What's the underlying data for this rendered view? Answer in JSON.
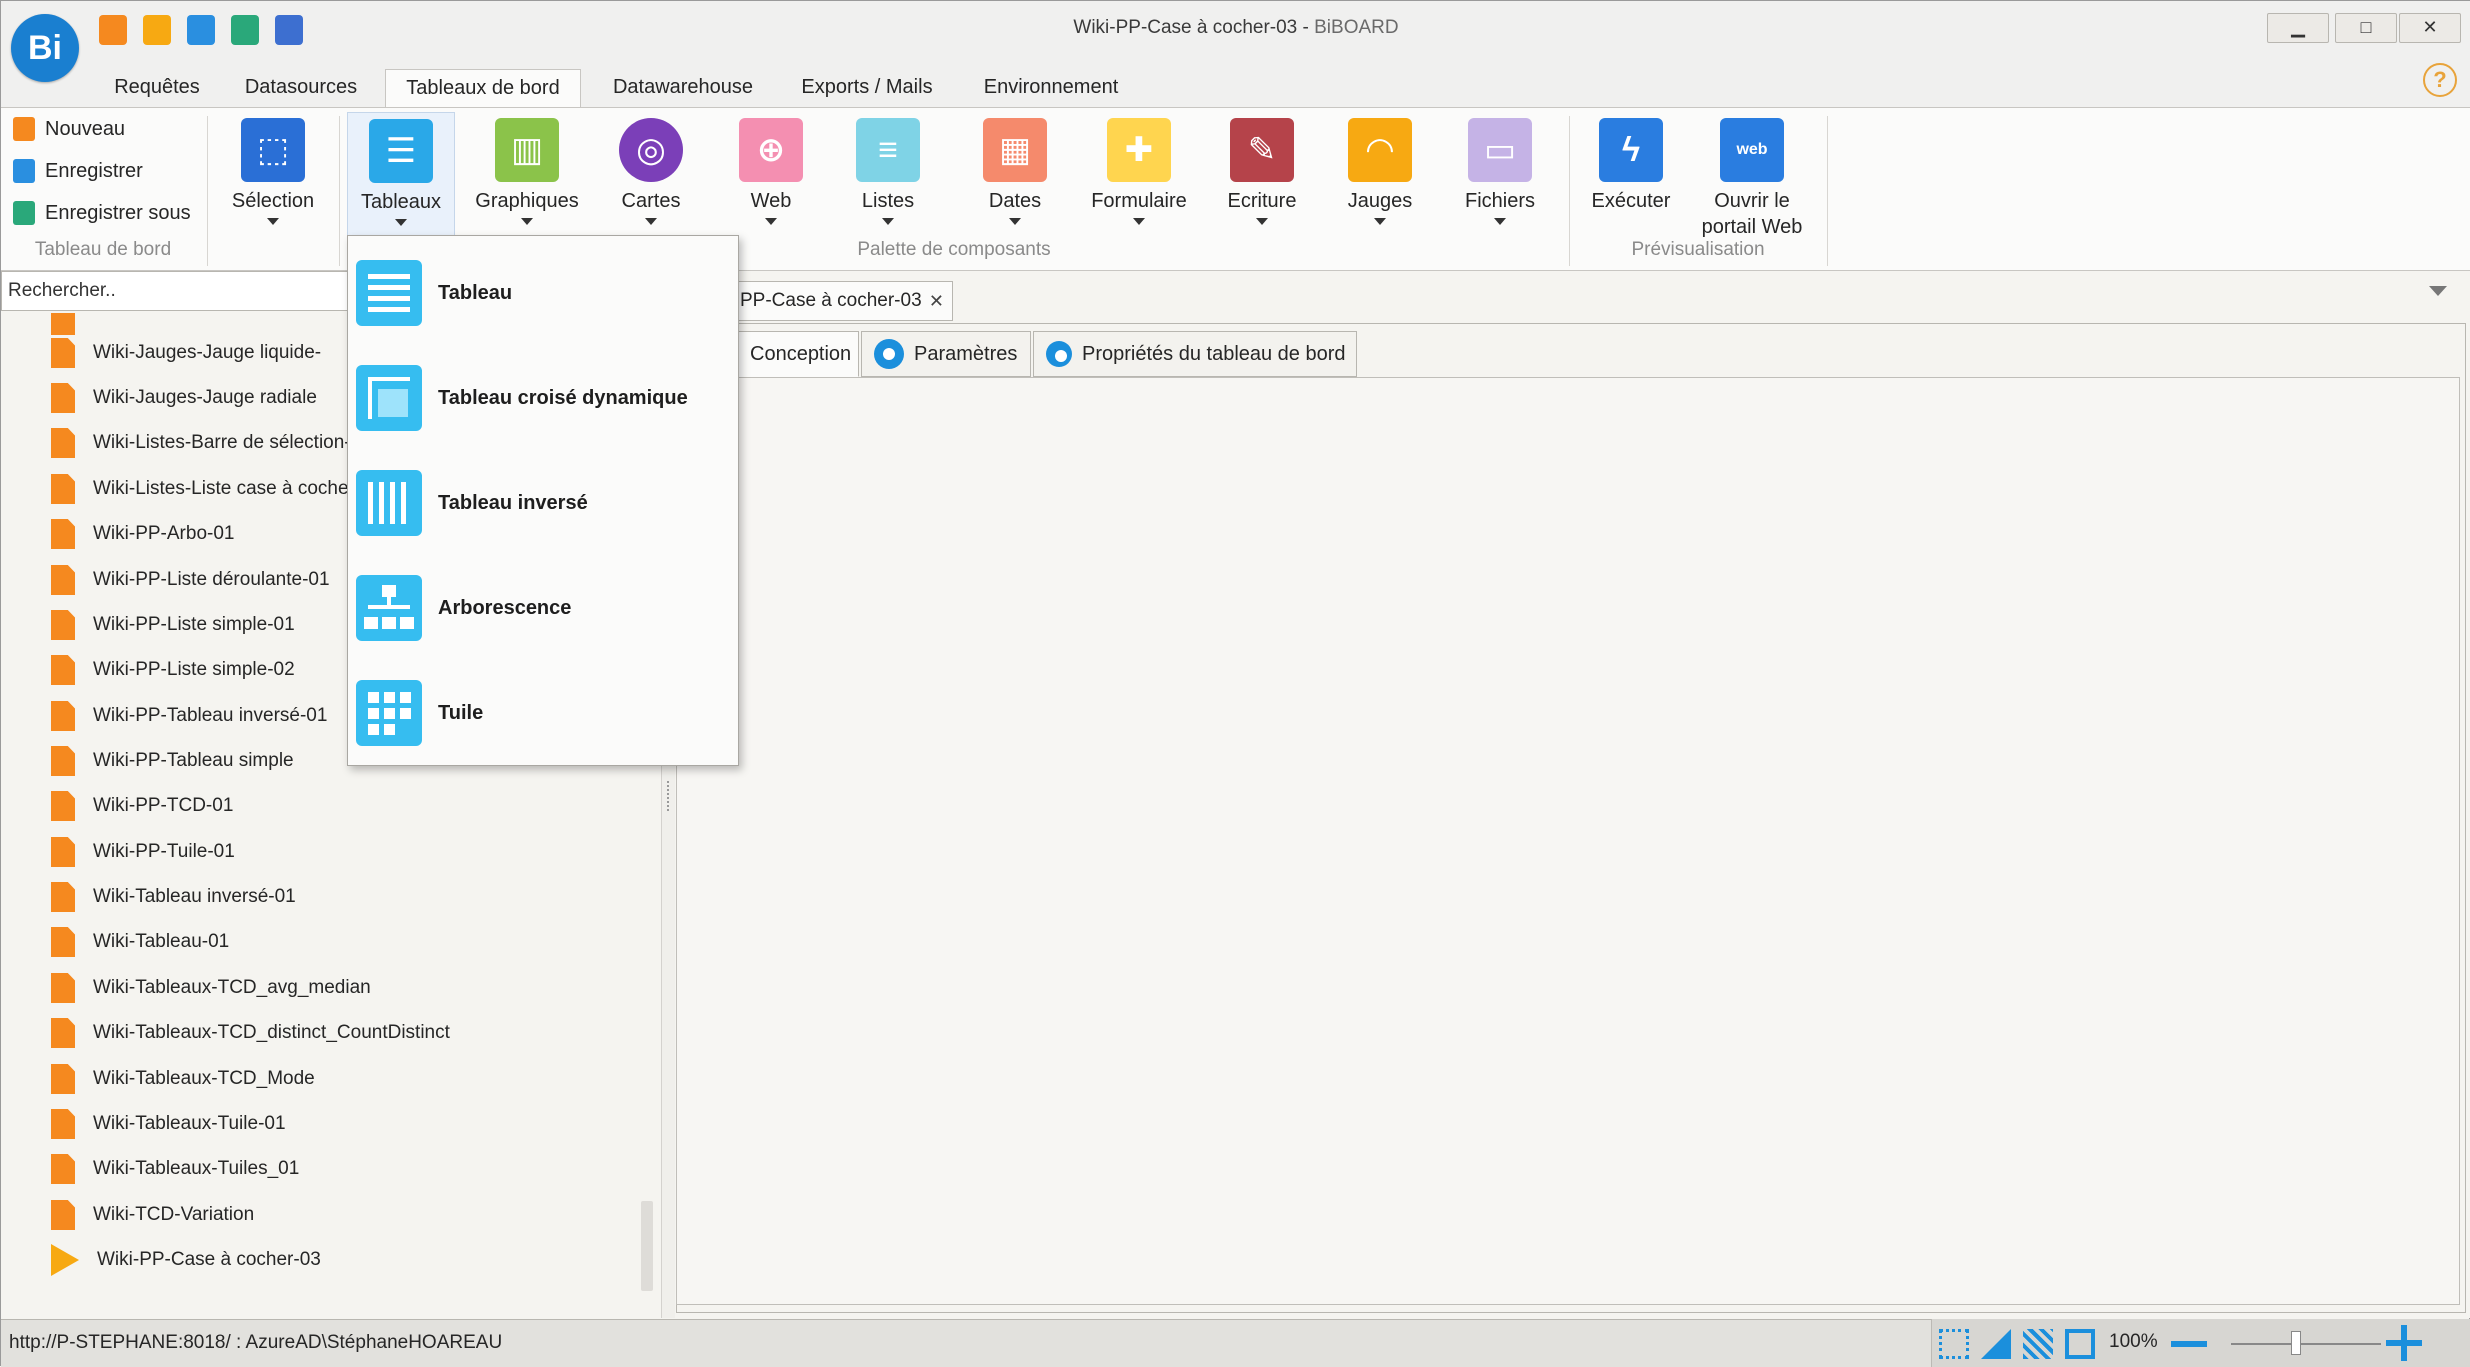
{
  "window": {
    "logo_text": "Bi",
    "title": "Wiki-PP-Case à cocher-03 - ",
    "app_name": "BiBOARD",
    "minimize": "▁",
    "maximize": "□",
    "close": "✕"
  },
  "menu_tabs": [
    "Requêtes",
    "Datasources",
    "Tableaux de bord",
    "Datawarehouse",
    "Exports / Mails",
    "Environnement"
  ],
  "help_icon": "?",
  "ribbon": {
    "tableau_de_bord": {
      "items": [
        "Nouveau",
        "Enregistrer",
        "Enregistrer sous"
      ],
      "label": "Tableau de bord"
    },
    "selection": {
      "label": "Sélection",
      "color": "#2a6fd6"
    },
    "palette": {
      "label": "Palette de composants",
      "buttons": [
        {
          "label": "Tableaux",
          "color": "#2aa8e8",
          "icon": "table-icon"
        },
        {
          "label": "Graphiques",
          "color": "#8bc34a",
          "icon": "bar-chart-icon"
        },
        {
          "label": "Cartes",
          "color": "#7b3fb8",
          "icon": "globe-icon"
        },
        {
          "label": "Web",
          "color": "#f48fb1",
          "icon": "web-icon"
        },
        {
          "label": "Listes",
          "color": "#7fd3e6",
          "icon": "list-icon"
        },
        {
          "label": "Dates",
          "color": "#f58a6c",
          "icon": "calendar-icon"
        },
        {
          "label": "Formulaire",
          "color": "#ffd54f",
          "icon": "plus-icon"
        },
        {
          "label": "Ecriture",
          "color": "#b5434a",
          "icon": "pen-icon"
        },
        {
          "label": "Jauges",
          "color": "#f7a912",
          "icon": "gauge-icon"
        },
        {
          "label": "Fichiers",
          "color": "#c5b3e6",
          "icon": "folder-icon"
        }
      ]
    },
    "previsualisation": {
      "label": "Prévisualisation",
      "executer": "Exécuter",
      "ouvrir_line1": "Ouvrir le",
      "ouvrir_line2": "portail Web",
      "web_badge": "web"
    }
  },
  "search": {
    "placeholder": "Rechercher.."
  },
  "tree": {
    "items": [
      "Wiki-Jauges-Jauge liquide-",
      "Wiki-Jauges-Jauge radiale",
      "Wiki-Listes-Barre de sélection-",
      "Wiki-Listes-Liste case à cocher",
      "Wiki-PP-Arbo-01",
      "Wiki-PP-Liste déroulante-01",
      "Wiki-PP-Liste simple-01",
      "Wiki-PP-Liste simple-02",
      "Wiki-PP-Tableau inversé-01",
      "Wiki-PP-Tableau simple",
      "Wiki-PP-TCD-01",
      "Wiki-PP-Tuile-01",
      "Wiki-Tableau inversé-01",
      "Wiki-Tableau-01",
      "Wiki-Tableaux-TCD_avg_median",
      "Wiki-Tableaux-TCD_distinct_CountDistinct",
      "Wiki-Tableaux-TCD_Mode",
      "Wiki-Tableaux-Tuile-01",
      "Wiki-Tableaux-Tuiles_01",
      "Wiki-TCD-Variation",
      "Wiki-PP-Case à cocher-03"
    ],
    "active_index": 20
  },
  "document": {
    "tab_title": "PP-Case à cocher-03",
    "tab_close": "✕",
    "subtabs": [
      "Conception",
      "Paramètres",
      "Propriétés du tableau de bord"
    ]
  },
  "dropdown_menu": {
    "items": [
      "Tableau",
      "Tableau croisé dynamique",
      "Tableau inversé",
      "Arborescence",
      "Tuile"
    ]
  },
  "statusbar": {
    "connection": "http://P-STEPHANE:8018/ : AzureAD\\StéphaneHOAREAU",
    "zoom": "100%"
  }
}
